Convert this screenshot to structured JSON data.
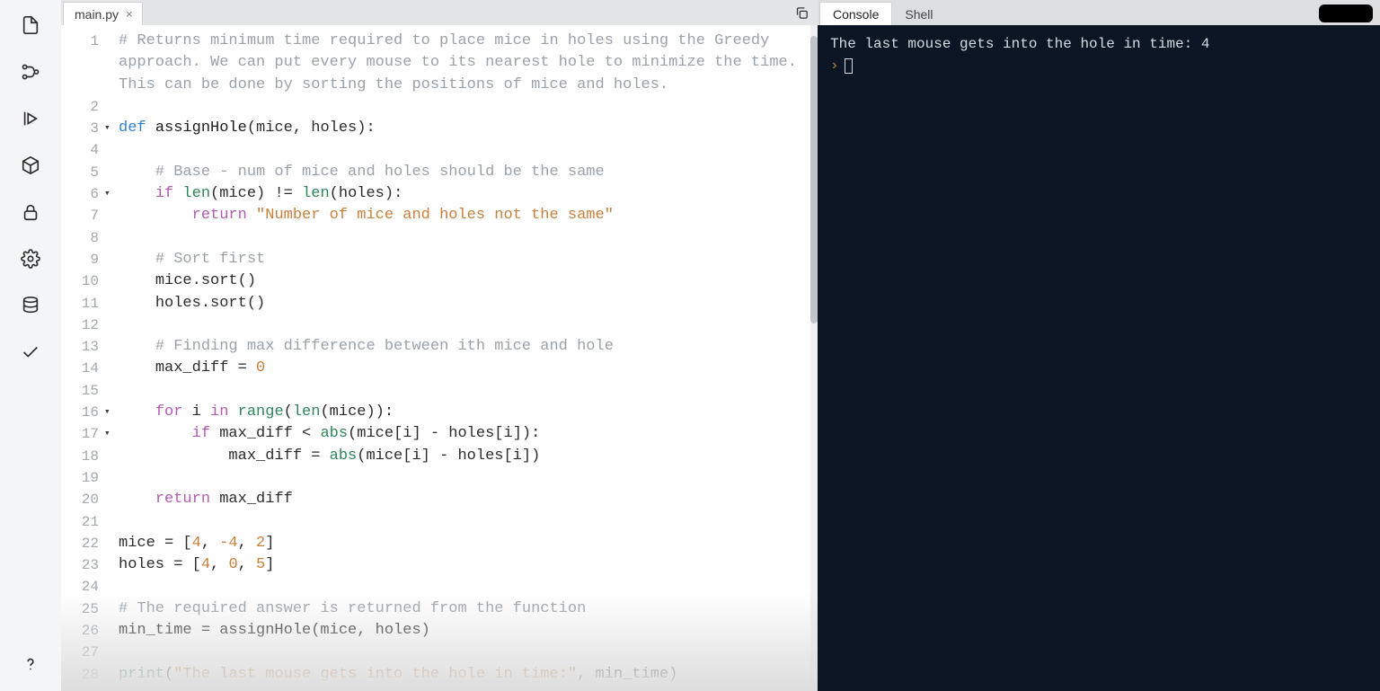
{
  "tabs": {
    "file": "main.py",
    "close_glyph": "×"
  },
  "console_tabs": {
    "console": "Console",
    "shell": "Shell"
  },
  "console_output": "The last mouse gets into the hole in time: 4",
  "console_prompt": "›",
  "editor": {
    "fold_markers": {
      "3": "▾",
      "6": "▾",
      "16": "▾",
      "17": "▾"
    },
    "lines": [
      {
        "n": 1,
        "segs": [
          {
            "c": "tok-comment",
            "t": "# Returns minimum time required to place mice in holes using the Greedy"
          }
        ]
      },
      {
        "n": null,
        "wrap_of": 1,
        "segs": [
          {
            "c": "tok-comment",
            "t": "approach. We can put every mouse to its nearest hole to minimize the time."
          }
        ]
      },
      {
        "n": null,
        "wrap_of": 1,
        "segs": [
          {
            "c": "tok-comment",
            "t": "This can be done by sorting the positions of mice and holes."
          }
        ]
      },
      {
        "n": 2,
        "segs": []
      },
      {
        "n": 3,
        "segs": [
          {
            "c": "tok-kw",
            "t": "def "
          },
          {
            "c": "tok-def",
            "t": "assignHole"
          },
          {
            "t": "(mice, holes):"
          }
        ]
      },
      {
        "n": 4,
        "segs": []
      },
      {
        "n": 5,
        "indent": 4,
        "segs": [
          {
            "c": "tok-comment",
            "t": "# Base - num of mice and holes should be the same"
          }
        ]
      },
      {
        "n": 6,
        "indent": 4,
        "segs": [
          {
            "c": "tok-ctrl",
            "t": "if"
          },
          {
            "t": " "
          },
          {
            "c": "tok-builtin",
            "t": "len"
          },
          {
            "t": "(mice) != "
          },
          {
            "c": "tok-builtin",
            "t": "len"
          },
          {
            "t": "(holes):"
          }
        ]
      },
      {
        "n": 7,
        "indent": 8,
        "segs": [
          {
            "c": "tok-ctrl",
            "t": "return"
          },
          {
            "t": " "
          },
          {
            "c": "tok-str",
            "t": "\"Number of mice and holes not the same\""
          }
        ]
      },
      {
        "n": 8,
        "segs": []
      },
      {
        "n": 9,
        "indent": 4,
        "segs": [
          {
            "c": "tok-comment",
            "t": "# Sort first"
          }
        ]
      },
      {
        "n": 10,
        "indent": 4,
        "segs": [
          {
            "t": "mice.sort()"
          }
        ]
      },
      {
        "n": 11,
        "indent": 4,
        "segs": [
          {
            "t": "holes.sort()"
          }
        ]
      },
      {
        "n": 12,
        "segs": []
      },
      {
        "n": 13,
        "indent": 4,
        "segs": [
          {
            "c": "tok-comment",
            "t": "# Finding max difference between ith mice and hole"
          }
        ]
      },
      {
        "n": 14,
        "indent": 4,
        "segs": [
          {
            "t": "max_diff = "
          },
          {
            "c": "tok-num",
            "t": "0"
          }
        ]
      },
      {
        "n": 15,
        "segs": []
      },
      {
        "n": 16,
        "indent": 4,
        "segs": [
          {
            "c": "tok-ctrl",
            "t": "for"
          },
          {
            "t": " i "
          },
          {
            "c": "tok-ctrl",
            "t": "in"
          },
          {
            "t": " "
          },
          {
            "c": "tok-builtin",
            "t": "range"
          },
          {
            "t": "("
          },
          {
            "c": "tok-builtin",
            "t": "len"
          },
          {
            "t": "(mice)):"
          }
        ]
      },
      {
        "n": 17,
        "indent": 8,
        "segs": [
          {
            "c": "tok-ctrl",
            "t": "if"
          },
          {
            "t": " max_diff < "
          },
          {
            "c": "tok-builtin",
            "t": "abs"
          },
          {
            "t": "(mice[i] - holes[i]):"
          }
        ]
      },
      {
        "n": 18,
        "indent": 12,
        "segs": [
          {
            "t": "max_diff = "
          },
          {
            "c": "tok-builtin",
            "t": "abs"
          },
          {
            "t": "(mice[i] - holes[i])"
          }
        ]
      },
      {
        "n": 19,
        "segs": []
      },
      {
        "n": 20,
        "indent": 4,
        "segs": [
          {
            "c": "tok-ctrl",
            "t": "return"
          },
          {
            "t": " max_diff"
          }
        ]
      },
      {
        "n": 21,
        "segs": []
      },
      {
        "n": 22,
        "segs": [
          {
            "t": "mice = ["
          },
          {
            "c": "tok-num",
            "t": "4"
          },
          {
            "t": ", "
          },
          {
            "c": "tok-num",
            "t": "-4"
          },
          {
            "t": ", "
          },
          {
            "c": "tok-num",
            "t": "2"
          },
          {
            "t": "]"
          }
        ]
      },
      {
        "n": 23,
        "segs": [
          {
            "t": "holes = ["
          },
          {
            "c": "tok-num",
            "t": "4"
          },
          {
            "t": ", "
          },
          {
            "c": "tok-num",
            "t": "0"
          },
          {
            "t": ", "
          },
          {
            "c": "tok-num",
            "t": "5"
          },
          {
            "t": "]"
          }
        ]
      },
      {
        "n": 24,
        "segs": []
      },
      {
        "n": 25,
        "segs": [
          {
            "c": "tok-comment",
            "t": "# The required answer is returned from the function"
          }
        ]
      },
      {
        "n": 26,
        "segs": [
          {
            "t": "min_time = assignHole(mice, holes)"
          }
        ]
      },
      {
        "n": 27,
        "segs": []
      },
      {
        "n": 28,
        "segs": [
          {
            "c": "tok-builtin",
            "t": "print"
          },
          {
            "t": "("
          },
          {
            "c": "tok-str",
            "t": "\"The last mouse gets into the hole in time:\""
          },
          {
            "t": ", min_time)"
          }
        ]
      }
    ]
  }
}
